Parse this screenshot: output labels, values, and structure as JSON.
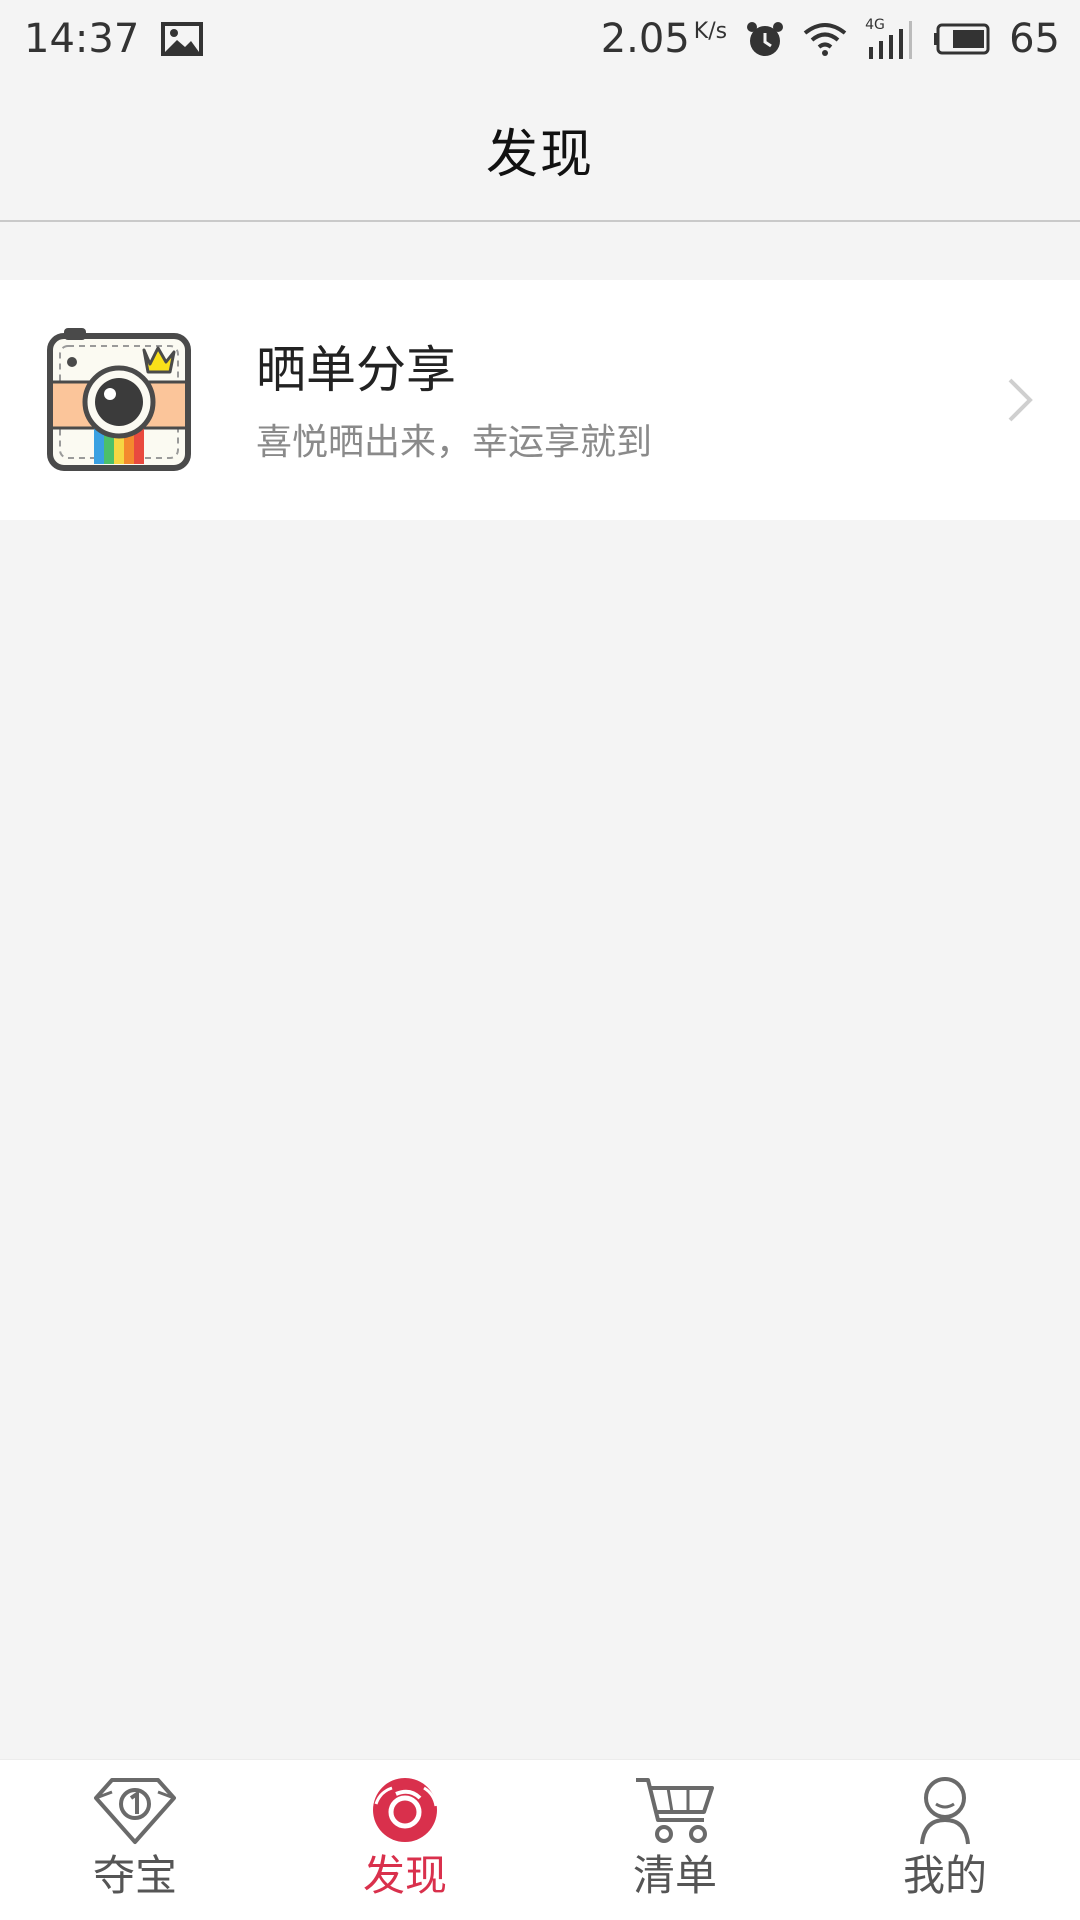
{
  "status_bar": {
    "time": "14:37",
    "speed": "2.05",
    "speed_unit": "K/s",
    "network": "4G",
    "battery": "65"
  },
  "header": {
    "title": "发现"
  },
  "discover": {
    "items": [
      {
        "title": "晒单分享",
        "subtitle": "喜悦晒出来，幸运享就到",
        "icon": "camera-icon"
      }
    ]
  },
  "bottom_nav": {
    "active_color": "#d9304c",
    "tabs": [
      {
        "label": "夺宝",
        "icon": "diamond-icon"
      },
      {
        "label": "发现",
        "icon": "discover-icon",
        "active": true
      },
      {
        "label": "清单",
        "icon": "cart-icon"
      },
      {
        "label": "我的",
        "icon": "user-icon"
      }
    ]
  }
}
